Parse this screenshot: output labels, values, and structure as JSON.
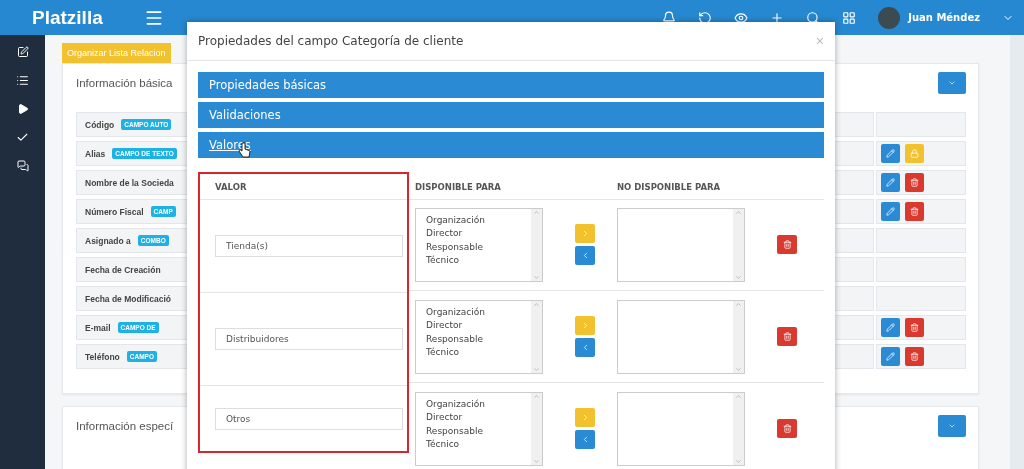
{
  "topbar": {
    "logo": "Platzilla",
    "user": "Juan Méndez"
  },
  "toolbar_button": "Organizar Lista Relacion",
  "basic_card": {
    "title": "Información básica",
    "rows": [
      {
        "label": "Código",
        "badge": "CAMPO AUTO",
        "actions": []
      },
      {
        "label": "Alias",
        "badge": "CAMPO DE TEXTO",
        "actions": [
          {
            "kind": "edit"
          },
          {
            "kind": "lock"
          }
        ]
      },
      {
        "label": "Nombre de la Socieda",
        "actions": [
          {
            "kind": "edit"
          },
          {
            "kind": "delete"
          }
        ]
      },
      {
        "label": "Número Fiscal",
        "badge": "CAMP",
        "actions": [
          {
            "kind": "edit"
          },
          {
            "kind": "delete"
          }
        ]
      },
      {
        "label": "Asignado a",
        "badge": "COMBO",
        "actions": []
      },
      {
        "label": "Fecha de Creación",
        "actions": []
      },
      {
        "label": "Fecha de Modificació",
        "actions": []
      },
      {
        "label": "E-mail",
        "badge": "CAMPO DE",
        "actions": [
          {
            "kind": "edit"
          },
          {
            "kind": "delete"
          }
        ]
      },
      {
        "label": "Teléfono",
        "badge": "CAMPO",
        "actions": [
          {
            "kind": "edit"
          },
          {
            "kind": "delete"
          }
        ]
      }
    ]
  },
  "specific_card": {
    "title": "Información especí"
  },
  "modal": {
    "title": "Propiedades del campo Categoría de cliente",
    "close": "×",
    "sections": [
      {
        "label": "Propiedades básicas",
        "selected": false
      },
      {
        "label": "Validaciones",
        "selected": false
      },
      {
        "label": "Valores",
        "selected": true
      }
    ],
    "columns": [
      "VALOR",
      "DISPONIBLE PARA",
      "NO DISPONIBLE PARA"
    ],
    "rows": [
      {
        "value": "Tienda(s)",
        "available": [
          "Organización",
          "Director",
          "Responsable",
          "Técnico"
        ]
      },
      {
        "value": "Distribuidores",
        "available": [
          "Organización",
          "Director",
          "Responsable",
          "Técnico"
        ]
      },
      {
        "value": "Otros",
        "available": [
          "Organización",
          "Director",
          "Responsable",
          "Técnico"
        ]
      }
    ]
  }
}
